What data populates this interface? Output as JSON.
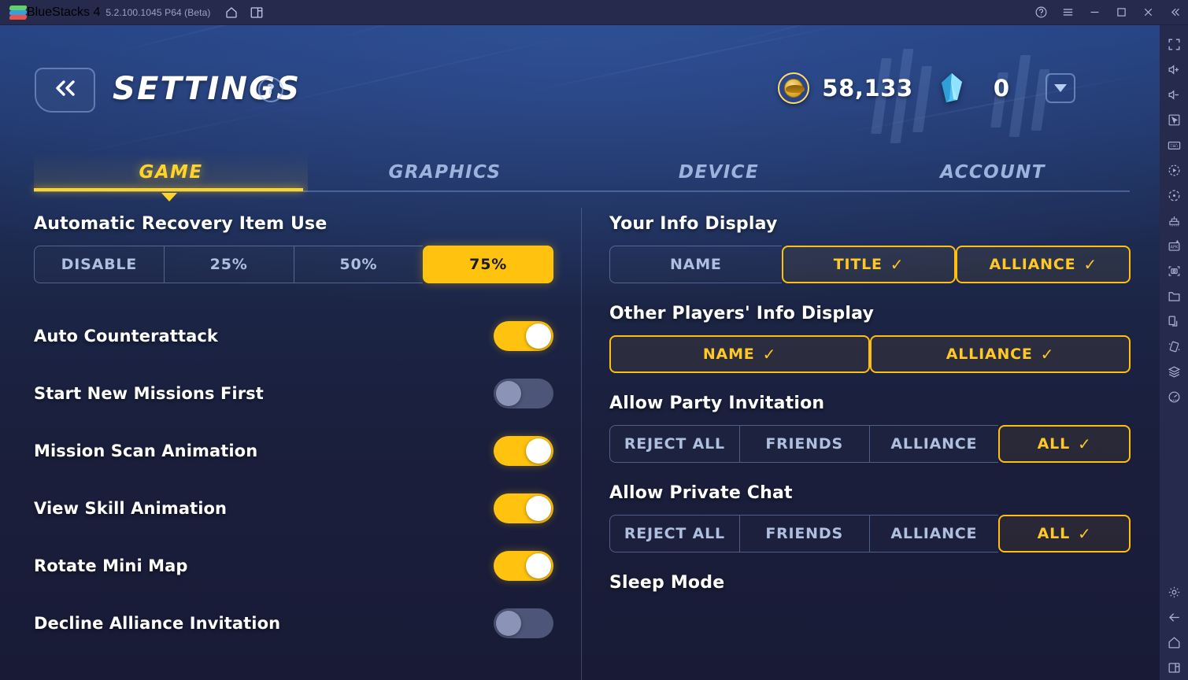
{
  "titlebar": {
    "app_name": "BlueStacks 4",
    "version": "5.2.100.1045 P64 (Beta)",
    "logo_icon": "bluestacks-logo-icon",
    "left_icons": [
      {
        "name": "home-icon",
        "label": "Home"
      },
      {
        "name": "multi-instance-icon",
        "label": "Multi-instance"
      }
    ],
    "right_icons": [
      {
        "name": "help-icon",
        "label": "Help"
      },
      {
        "name": "hamburger-menu-icon",
        "label": "Menu"
      },
      {
        "name": "minimize-icon",
        "label": "Minimize"
      },
      {
        "name": "maximize-icon",
        "label": "Maximize"
      },
      {
        "name": "close-icon",
        "label": "Close"
      },
      {
        "name": "collapse-icon",
        "label": "Collapse sidebar"
      }
    ]
  },
  "header": {
    "back_icon": "double-chevron-left-icon",
    "title": "SETTINGS",
    "help_badge": "?",
    "currency": {
      "gold_icon": "gold-coin-icon",
      "gold_value": "58,133",
      "gem_icon": "blue-crystal-icon",
      "gem_value": "0",
      "more_icon": "chevron-down-icon"
    }
  },
  "tabs": [
    {
      "label": "GAME",
      "active": true
    },
    {
      "label": "GRAPHICS",
      "active": false
    },
    {
      "label": "DEVICE",
      "active": false
    },
    {
      "label": "ACCOUNT",
      "active": false
    }
  ],
  "left_column": {
    "recovery": {
      "title": "Automatic Recovery Item Use",
      "options": [
        {
          "label": "DISABLE",
          "state": "unselected"
        },
        {
          "label": "25%",
          "state": "unselected"
        },
        {
          "label": "50%",
          "state": "unselected"
        },
        {
          "label": "75%",
          "state": "selected-fill"
        }
      ]
    },
    "toggles": [
      {
        "label": "Auto Counterattack",
        "on": true
      },
      {
        "label": "Start New Missions First",
        "on": false
      },
      {
        "label": "Mission Scan Animation",
        "on": true
      },
      {
        "label": "View Skill Animation",
        "on": true
      },
      {
        "label": "Rotate Mini Map",
        "on": true
      },
      {
        "label": "Decline Alliance Invitation",
        "on": false
      }
    ]
  },
  "right_column": {
    "your_info": {
      "title": "Your Info Display",
      "options": [
        {
          "label": "NAME",
          "state": "unselected",
          "check": ""
        },
        {
          "label": "TITLE",
          "state": "selected-outline",
          "check": "✓"
        },
        {
          "label": "ALLIANCE",
          "state": "selected-outline",
          "check": "✓"
        }
      ]
    },
    "other_info": {
      "title": "Other Players' Info Display",
      "options": [
        {
          "label": "NAME",
          "state": "selected-outline",
          "check": "✓"
        },
        {
          "label": "ALLIANCE",
          "state": "selected-outline",
          "check": "✓"
        }
      ]
    },
    "party_invitation": {
      "title": "Allow Party Invitation",
      "options": [
        {
          "label": "REJECT ALL",
          "state": "unselected",
          "check": ""
        },
        {
          "label": "FRIENDS",
          "state": "unselected",
          "check": ""
        },
        {
          "label": "ALLIANCE",
          "state": "unselected",
          "check": ""
        },
        {
          "label": "ALL",
          "state": "selected-outline",
          "check": "✓"
        }
      ]
    },
    "private_chat": {
      "title": "Allow Private Chat",
      "options": [
        {
          "label": "REJECT ALL",
          "state": "unselected",
          "check": ""
        },
        {
          "label": "FRIENDS",
          "state": "unselected",
          "check": ""
        },
        {
          "label": "ALLIANCE",
          "state": "unselected",
          "check": ""
        },
        {
          "label": "ALL",
          "state": "selected-outline",
          "check": "✓"
        }
      ]
    },
    "sleep_mode": {
      "title": "Sleep Mode"
    }
  },
  "sidebar_icons": [
    {
      "name": "fullscreen-icon"
    },
    {
      "name": "volume-up-icon"
    },
    {
      "name": "volume-down-icon"
    },
    {
      "name": "cursor-pointer-icon"
    },
    {
      "name": "keyboard-controls-icon"
    },
    {
      "name": "record-macro-icon"
    },
    {
      "name": "rotate-icon"
    },
    {
      "name": "game-controls-icon"
    },
    {
      "name": "install-apk-icon"
    },
    {
      "name": "screenshot-icon"
    },
    {
      "name": "media-folder-icon"
    },
    {
      "name": "multi-instance-icon"
    },
    {
      "name": "shake-tilt-icon"
    },
    {
      "name": "layers-icon"
    },
    {
      "name": "performance-meter-icon"
    }
  ],
  "sidebar_bottom_icons": [
    {
      "name": "gear-icon"
    },
    {
      "name": "back-arrow-icon"
    },
    {
      "name": "home-icon"
    },
    {
      "name": "recent-apps-icon"
    }
  ],
  "colors": {
    "accent_yellow": "#FFC20E",
    "tab_active": "#ffd42a",
    "titlebar_bg": "#262b4d",
    "panel_bg": "#1b1d3a",
    "toggle_off": "#4d5578"
  }
}
